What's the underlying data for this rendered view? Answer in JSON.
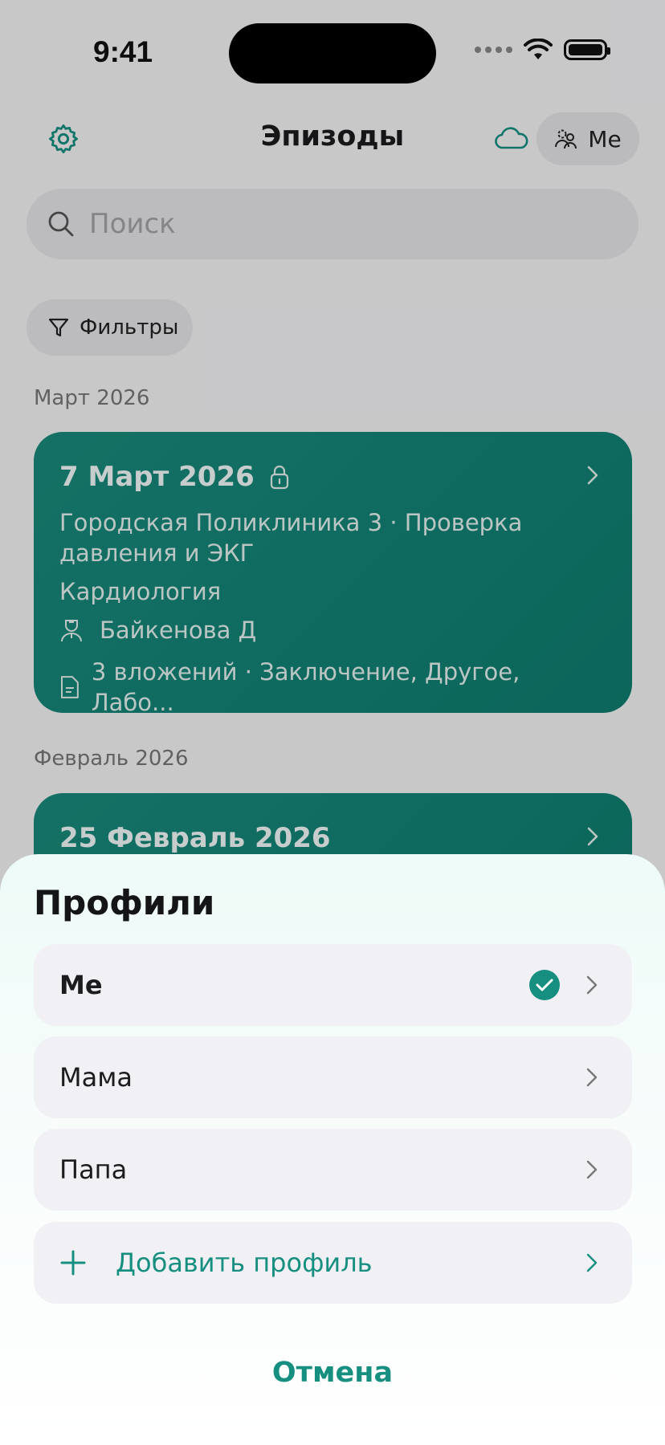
{
  "status_bar": {
    "time": "9:41"
  },
  "nav": {
    "title": "Эпизоды",
    "profile_label": "Me"
  },
  "search": {
    "placeholder": "Поиск"
  },
  "filters": {
    "label": "Фильтры"
  },
  "sections": [
    {
      "label": "Март 2026",
      "card": {
        "date": "7 Март 2026",
        "locked": true,
        "clinic": "Городская Поликлиника 3 · Проверка давления и ЭКГ",
        "specialty": "Кардиология",
        "doctor": "Байкенова Д",
        "attachments": "3 вложений · Заключение, Другое, Лабо..."
      }
    },
    {
      "label": "Февраль 2026",
      "card": {
        "date": "25 Февраль 2026"
      }
    }
  ],
  "sheet": {
    "title": "Профили",
    "profiles": [
      {
        "label": "Me",
        "selected": true
      },
      {
        "label": "Мама",
        "selected": false
      },
      {
        "label": "Папа",
        "selected": false
      }
    ],
    "add_label": "Добавить профиль",
    "cancel_label": "Отмена"
  },
  "colors": {
    "accent": "#178f80",
    "card": "#138376"
  }
}
